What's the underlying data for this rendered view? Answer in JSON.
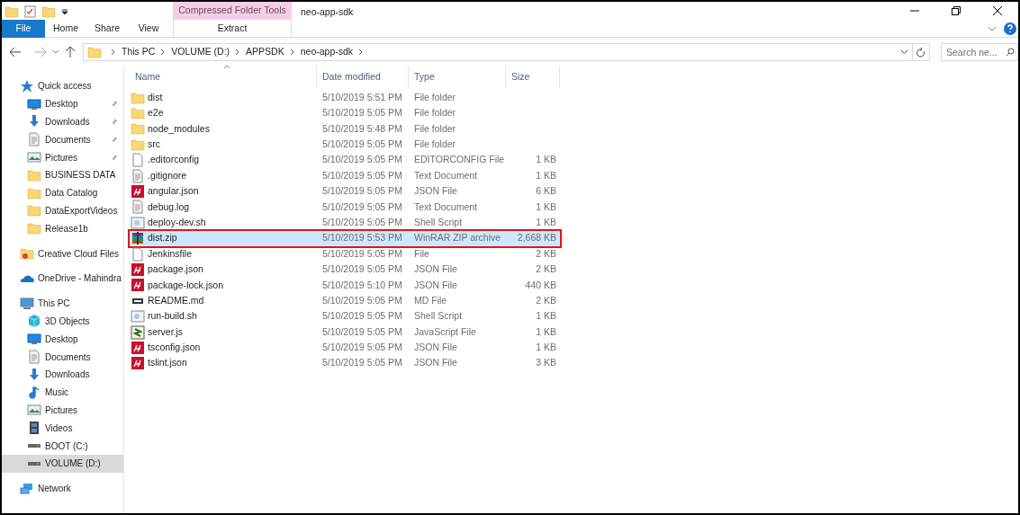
{
  "window": {
    "title": "neo-app-sdk",
    "context_tab_group": "Compressed Folder Tools"
  },
  "ribbon_tabs": [
    {
      "label": "File",
      "kind": "file",
      "selected": false
    },
    {
      "label": "Home",
      "kind": "tab",
      "selected": false
    },
    {
      "label": "Share",
      "kind": "tab",
      "selected": false
    },
    {
      "label": "View",
      "kind": "tab",
      "selected": false
    },
    {
      "label": "Extract",
      "kind": "context",
      "selected": false
    }
  ],
  "breadcrumb": [
    "This PC",
    "VOLUME (D:)",
    "APPSDK",
    "neo-app-sdk"
  ],
  "search": {
    "placeholder": "Search ne..."
  },
  "sidebar": {
    "items": [
      {
        "label": "Quick access",
        "kind": "star",
        "selected": false,
        "children": [
          {
            "label": "Desktop",
            "kind": "desktop",
            "pinned": true,
            "selected": false
          },
          {
            "label": "Downloads",
            "kind": "download",
            "pinned": true,
            "selected": false
          },
          {
            "label": "Documents",
            "kind": "document",
            "pinned": true,
            "selected": false
          },
          {
            "label": "Pictures",
            "kind": "pictures",
            "pinned": true,
            "selected": false
          },
          {
            "label": "BUSINESS DATA",
            "kind": "folder",
            "pinned": false,
            "selected": false
          },
          {
            "label": "Data Catalog",
            "kind": "folder",
            "pinned": false,
            "selected": false
          },
          {
            "label": "DataExportVideos",
            "kind": "folder",
            "pinned": false,
            "selected": false
          },
          {
            "label": "Release1b",
            "kind": "folder",
            "pinned": false,
            "selected": false
          }
        ]
      },
      {
        "label": "Creative Cloud Files",
        "kind": "cloudfolder",
        "selected": false
      },
      {
        "label": "OneDrive - Mahindra",
        "kind": "cloud",
        "selected": false
      },
      {
        "label": "This PC",
        "kind": "pc",
        "selected": false,
        "children": [
          {
            "label": "3D Objects",
            "kind": "cube",
            "pinned": false,
            "selected": false
          },
          {
            "label": "Desktop",
            "kind": "desktop",
            "pinned": false,
            "selected": false
          },
          {
            "label": "Documents",
            "kind": "document",
            "pinned": false,
            "selected": false
          },
          {
            "label": "Downloads",
            "kind": "download",
            "pinned": false,
            "selected": false
          },
          {
            "label": "Music",
            "kind": "music",
            "pinned": false,
            "selected": false
          },
          {
            "label": "Pictures",
            "kind": "pictures",
            "pinned": false,
            "selected": false
          },
          {
            "label": "Videos",
            "kind": "videos",
            "pinned": false,
            "selected": false
          },
          {
            "label": "BOOT (C:)",
            "kind": "drive",
            "pinned": false,
            "selected": false
          },
          {
            "label": "VOLUME (D:)",
            "kind": "drive",
            "pinned": false,
            "selected": true
          }
        ]
      },
      {
        "label": "Network",
        "kind": "network",
        "selected": false
      }
    ]
  },
  "table": {
    "columns": [
      "Name",
      "Date modified",
      "Type",
      "Size"
    ],
    "rows": [
      {
        "name": "dist",
        "date": "5/10/2019 5:51 PM",
        "type": "File folder",
        "kind": "folder",
        "selected": false,
        "highlighted": false
      },
      {
        "name": "e2e",
        "date": "5/10/2019 5:05 PM",
        "type": "File folder",
        "kind": "folder",
        "selected": false,
        "highlighted": false
      },
      {
        "name": "node_modules",
        "date": "5/10/2019 5:48 PM",
        "type": "File folder",
        "kind": "folder",
        "selected": false,
        "highlighted": false
      },
      {
        "name": "src",
        "date": "5/10/2019 5:05 PM",
        "type": "File folder",
        "kind": "folder",
        "selected": false,
        "highlighted": false
      },
      {
        "name": ".editorconfig",
        "date": "5/10/2019 5:05 PM",
        "type": "EDITORCONFIG File",
        "size": "1 KB",
        "kind": "blank",
        "selected": false,
        "highlighted": false
      },
      {
        "name": ".gitignore",
        "date": "5/10/2019 5:05 PM",
        "type": "Text Document",
        "size": "1 KB",
        "kind": "text",
        "selected": false,
        "highlighted": false
      },
      {
        "name": "angular.json",
        "date": "5/10/2019 5:05 PM",
        "type": "JSON File",
        "size": "6 KB",
        "kind": "json",
        "selected": false,
        "highlighted": false
      },
      {
        "name": "debug.log",
        "date": "5/10/2019 5:05 PM",
        "type": "Text Document",
        "size": "1 KB",
        "kind": "text",
        "selected": false,
        "highlighted": false
      },
      {
        "name": "deploy-dev.sh",
        "date": "5/10/2019 5:05 PM",
        "type": "Shell Script",
        "size": "1 KB",
        "kind": "shell",
        "selected": false,
        "highlighted": false
      },
      {
        "name": "dist.zip",
        "date": "5/10/2019 5:53 PM",
        "type": "WinRAR ZIP archive",
        "size": "2,668 KB",
        "kind": "zip",
        "selected": true,
        "highlighted": true
      },
      {
        "name": "Jenkinsfile",
        "date": "5/10/2019 5:05 PM",
        "type": "File",
        "size": "2 KB",
        "kind": "blank",
        "selected": false,
        "highlighted": false
      },
      {
        "name": "package.json",
        "date": "5/10/2019 5:05 PM",
        "type": "JSON File",
        "size": "2 KB",
        "kind": "json",
        "selected": false,
        "highlighted": false
      },
      {
        "name": "package-lock.json",
        "date": "5/10/2019 5:10 PM",
        "type": "JSON File",
        "size": "440 KB",
        "kind": "json",
        "selected": false,
        "highlighted": false
      },
      {
        "name": "README.md",
        "date": "5/10/2019 5:05 PM",
        "type": "MD File",
        "size": "2 KB",
        "kind": "md",
        "selected": false,
        "highlighted": false
      },
      {
        "name": "run-build.sh",
        "date": "5/10/2019 5:05 PM",
        "type": "Shell Script",
        "size": "1 KB",
        "kind": "shell",
        "selected": false,
        "highlighted": false
      },
      {
        "name": "server.js",
        "date": "5/10/2019 5:05 PM",
        "type": "JavaScript File",
        "size": "1 KB",
        "kind": "js",
        "selected": false,
        "highlighted": false
      },
      {
        "name": "tsconfig.json",
        "date": "5/10/2019 5:05 PM",
        "type": "JSON File",
        "size": "1 KB",
        "kind": "json",
        "selected": false,
        "highlighted": false
      },
      {
        "name": "tslint.json",
        "date": "5/10/2019 5:05 PM",
        "type": "JSON File",
        "size": "3 KB",
        "kind": "json",
        "selected": false,
        "highlighted": false
      }
    ]
  }
}
